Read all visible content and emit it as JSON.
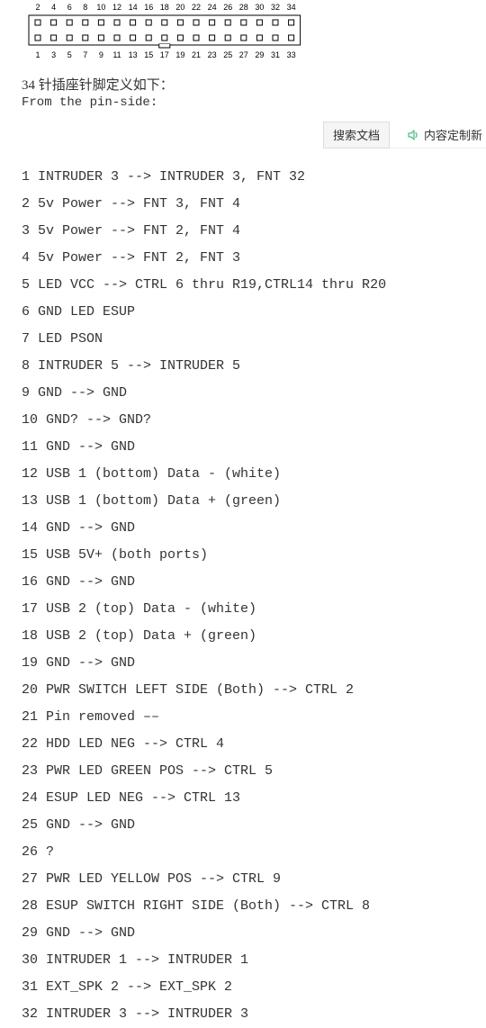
{
  "header_pins_top": [
    "2",
    "4",
    "6",
    "8",
    "10",
    "12",
    "14",
    "16",
    "18",
    "20",
    "22",
    "24",
    "26",
    "28",
    "30",
    "32",
    "34"
  ],
  "header_pins_bottom": [
    "1",
    "3",
    "5",
    "7",
    "9",
    "11",
    "13",
    "15",
    "17",
    "19",
    "21",
    "23",
    "25",
    "27",
    "29",
    "31",
    "33"
  ],
  "intro": "34 针插座针脚定义如下：",
  "intro_sub": "From the pin-side:",
  "toolbar": {
    "search_button": "搜索文档",
    "customize": "内容定制新"
  },
  "pins": [
    {
      "n": "1",
      "t": "INTRUDER 3 --> INTRUDER 3, FNT 32"
    },
    {
      "n": "2",
      "t": "5v Power --> FNT 3, FNT 4"
    },
    {
      "n": "3",
      "t": "5v Power --> FNT 2, FNT 4"
    },
    {
      "n": "4",
      "t": "5v Power --> FNT 2, FNT 3"
    },
    {
      "n": "5",
      "t": "LED VCC --> CTRL 6 thru R19,CTRL14 thru R20"
    },
    {
      "n": "6",
      "t": "GND LED ESUP"
    },
    {
      "n": "7",
      "t": "LED PSON"
    },
    {
      "n": "8",
      "t": "INTRUDER 5 --> INTRUDER 5"
    },
    {
      "n": "9",
      "t": "GND --> GND"
    },
    {
      "n": "10",
      "t": "GND? --> GND?"
    },
    {
      "n": "11",
      "t": "GND --> GND"
    },
    {
      "n": "12",
      "t": "USB 1 (bottom) Data - (white)"
    },
    {
      "n": "13",
      "t": "USB 1 (bottom) Data + (green)"
    },
    {
      "n": "14",
      "t": "GND --> GND"
    },
    {
      "n": "15",
      "t": "USB 5V+ (both ports)"
    },
    {
      "n": "16",
      "t": "GND --> GND"
    },
    {
      "n": "17",
      "t": "USB 2 (top) Data - (white)"
    },
    {
      "n": "18",
      "t": "USB 2 (top) Data + (green)"
    },
    {
      "n": "19",
      "t": "GND --> GND"
    },
    {
      "n": "20",
      "t": "PWR SWITCH LEFT SIDE (Both) --> CTRL 2"
    },
    {
      "n": "21",
      "t": "Pin removed ––"
    },
    {
      "n": "22",
      "t": "HDD LED NEG --> CTRL 4"
    },
    {
      "n": "23",
      "t": "PWR LED GREEN POS --> CTRL 5"
    },
    {
      "n": "24",
      "t": "ESUP LED NEG --> CTRL 13"
    },
    {
      "n": "25",
      "t": "GND --> GND"
    },
    {
      "n": "26",
      "t": "?"
    },
    {
      "n": "27",
      "t": "PWR LED YELLOW POS --> CTRL 9"
    },
    {
      "n": "28",
      "t": "ESUP SWITCH RIGHT SIDE (Both) --> CTRL 8"
    },
    {
      "n": "29",
      "t": "GND --> GND"
    },
    {
      "n": "30",
      "t": "INTRUDER 1 --> INTRUDER 1"
    },
    {
      "n": "31",
      "t": "EXT_SPK 2 --> EXT_SPK 2"
    },
    {
      "n": "32",
      "t": "INTRUDER 3 --> INTRUDER 3"
    }
  ]
}
